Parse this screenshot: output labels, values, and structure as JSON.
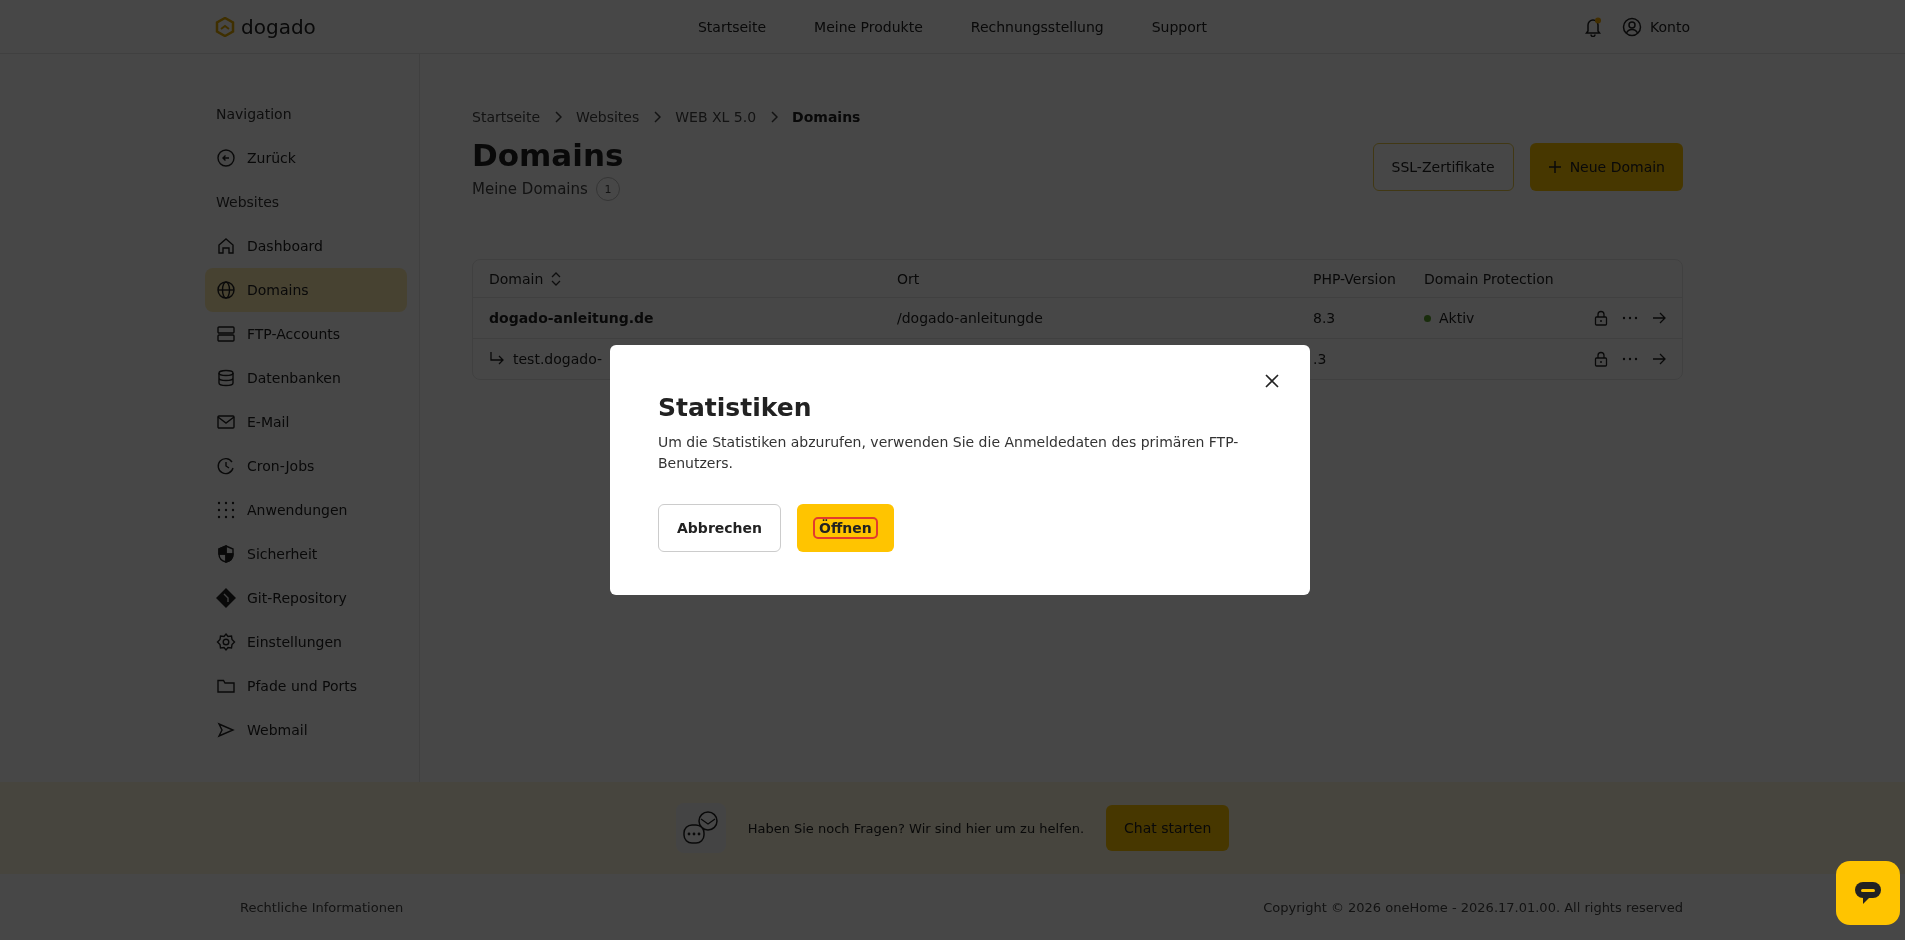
{
  "header": {
    "logo": "dogado",
    "nav": [
      {
        "label": "Startseite"
      },
      {
        "label": "Meine Produkte"
      },
      {
        "label": "Rechnungsstellung"
      },
      {
        "label": "Support"
      }
    ],
    "notification_dot": true,
    "account": "Konto"
  },
  "sidebar": {
    "sections": [
      {
        "title": "Navigation",
        "items": [
          {
            "label": "Zurück",
            "selected": false
          }
        ]
      },
      {
        "title": "Websites",
        "items": [
          {
            "label": "Dashboard",
            "selected": false
          },
          {
            "label": "Domains",
            "selected": true
          },
          {
            "label": "FTP-Accounts",
            "selected": false
          },
          {
            "label": "Datenbanken",
            "selected": false
          },
          {
            "label": "E-Mail",
            "selected": false
          },
          {
            "label": "Cron-Jobs",
            "selected": false
          },
          {
            "label": "Anwendungen",
            "selected": false
          },
          {
            "label": "Sicherheit",
            "selected": false
          },
          {
            "label": "Git-Repository",
            "selected": false
          },
          {
            "label": "Einstellungen",
            "selected": false
          },
          {
            "label": "Pfade und Ports",
            "selected": false
          },
          {
            "label": "Webmail",
            "selected": false
          }
        ]
      }
    ]
  },
  "breadcrumb": [
    "Startseite",
    "Websites",
    "WEB XL 5.0",
    "Domains"
  ],
  "page": {
    "title": "Domains",
    "subtitle": "Meine Domains",
    "count": "1",
    "buttons": [
      {
        "label": "SSL-Zertifikate",
        "kind": "outline"
      },
      {
        "label": "Neue Domain",
        "kind": "primary"
      }
    ]
  },
  "table": {
    "columns": [
      "Domain",
      "Ort",
      "PHP-Version",
      "Domain Protection"
    ],
    "rows": [
      {
        "domain": "dogado-anleitung.de",
        "ort": "/dogado-anleitungde",
        "php": "8.3",
        "protection": "Aktiv",
        "color": "#192d0c",
        "children": [
          {
            "domain": "test.dogado-",
            "php": ".3"
          }
        ]
      }
    ]
  },
  "chat_band": {
    "text": "Haben Sie noch Fragen? Wir sind hier um zu helfen.",
    "button": "Chat starten"
  },
  "footer": {
    "link": "Rechtliche Informationen",
    "copyright": "Copyright © 2026 oneHome - 2026.17.01.00. All rights reserved"
  },
  "modal": {
    "title": "Statistiken",
    "text": "Um die Statistiken abzurufen, verwenden Sie die Anmeldedaten des primären FTP-Benutzers.",
    "buttons": [
      {
        "label": "Abbrechen",
        "kind": "secondary",
        "focused": false
      },
      {
        "label": "Öffnen",
        "kind": "primary",
        "focused": true
      }
    ]
  }
}
